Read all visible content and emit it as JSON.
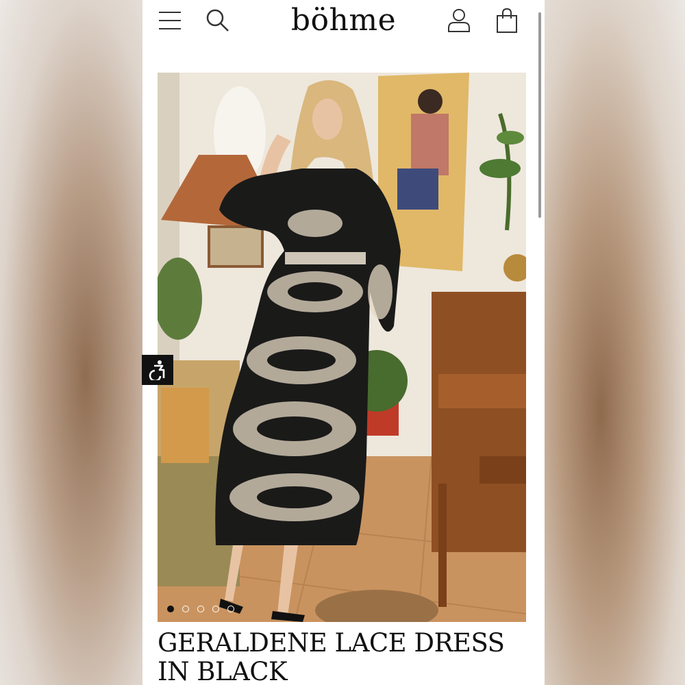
{
  "header": {
    "brand": "böhme",
    "menu_icon": "hamburger-menu-icon",
    "search_icon": "search-icon",
    "account_icon": "user-icon",
    "bag_icon": "shopping-bag-icon"
  },
  "product": {
    "title": "GERALDENE LACE DRESS IN BLACK",
    "image_alt": "Model wearing black lace maxi dress in a living room"
  },
  "carousel": {
    "total_slides": 5,
    "active_index": 0
  },
  "accessibility": {
    "icon": "accessibility-icon"
  },
  "colors": {
    "brand_text": "#111111",
    "accessibility_bg": "#111111"
  }
}
